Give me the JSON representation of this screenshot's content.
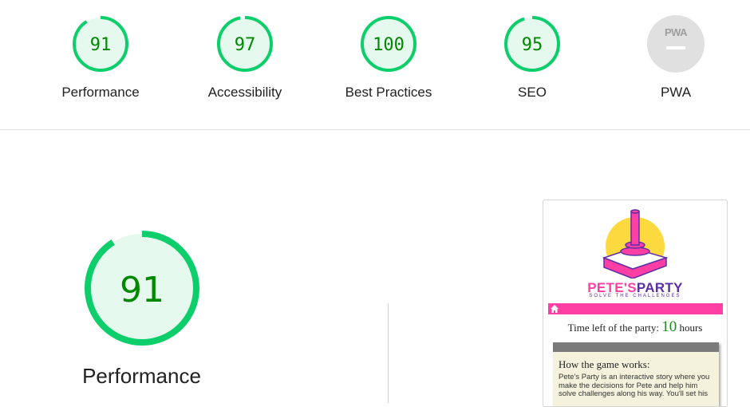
{
  "categories": [
    {
      "label": "Performance",
      "score": "91",
      "fraction": 0.91
    },
    {
      "label": "Accessibility",
      "score": "97",
      "fraction": 0.97
    },
    {
      "label": "Best Practices",
      "score": "100",
      "fraction": 1.0
    },
    {
      "label": "SEO",
      "score": "95",
      "fraction": 0.95
    },
    {
      "label": "PWA",
      "score": "",
      "badge": "PWA"
    }
  ],
  "performance": {
    "score": "91",
    "fraction": 0.91,
    "label": "Performance"
  },
  "colors": {
    "pass": "#0cce6b",
    "pass_bg": "#e6f9ee",
    "pass_text": "#008800",
    "na_gray": "#e0e0e0",
    "brand_pink": "#ff3fa4",
    "brand_purple": "#5b2ea6"
  },
  "screenshot": {
    "brand_part1": "PETE'S",
    "brand_part2": "PARTY",
    "brand_sub": "SOLVE THE CHALLENGES",
    "time_prefix": "Time left of the party:",
    "time_value": "10",
    "time_suffix": "hours",
    "card_title": "How the game works:",
    "card_text": "Pete's Party is an interactive story where you make the decisions for Pete and help him solve challenges along his way. You'll set his"
  }
}
